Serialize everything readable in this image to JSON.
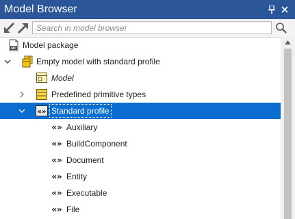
{
  "window": {
    "title": "Model Browser",
    "pin_icon": "pin-icon",
    "close_icon": "close-icon"
  },
  "toolbar": {
    "back_icon": "arrow-back-icon",
    "forward_icon": "arrow-forward-icon",
    "search_placeholder": "Search in model browser",
    "search_icon": "magnifier-icon"
  },
  "tree": {
    "items": [
      {
        "label": "Model package",
        "icon": "mp-package-icon",
        "expander": "none"
      },
      {
        "label": "Empty model with standard profile",
        "icon": "model-folder-icon",
        "expander": "expanded"
      },
      {
        "label": "Model",
        "icon": "diagram-icon",
        "expander": "none",
        "italic": true
      },
      {
        "label": "Predefined primitive types",
        "icon": "package-icon",
        "expander": "collapsed"
      },
      {
        "label": "Standard profile",
        "icon": "profile-icon",
        "expander": "expanded",
        "selected": true
      },
      {
        "label": "Auxiliary",
        "icon": "stereotype-icon",
        "expander": "none"
      },
      {
        "label": "BuildComponent",
        "icon": "stereotype-icon",
        "expander": "none"
      },
      {
        "label": "Document",
        "icon": "stereotype-icon",
        "expander": "none"
      },
      {
        "label": "Entity",
        "icon": "stereotype-icon",
        "expander": "none"
      },
      {
        "label": "Executable",
        "icon": "stereotype-icon",
        "expander": "none"
      },
      {
        "label": "File",
        "icon": "stereotype-icon",
        "expander": "none"
      }
    ]
  },
  "colors": {
    "title_bar": "#2b579a",
    "selection": "#0a6ed1",
    "package_yellow": "#f5c518"
  }
}
